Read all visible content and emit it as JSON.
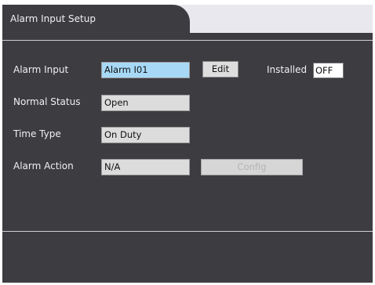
{
  "tab": {
    "title": "Alarm Input Setup"
  },
  "form": {
    "alarm_input": {
      "label": "Alarm Input",
      "value": "Alarm I01",
      "edit_label": "Edit"
    },
    "installed": {
      "label": "Installed",
      "value": "OFF"
    },
    "normal_status": {
      "label": "Normal Status",
      "value": "Open"
    },
    "time_type": {
      "label": "Time Type",
      "value": "On Duty"
    },
    "alarm_action": {
      "label": "Alarm Action",
      "value": "N/A",
      "config_label": "Config"
    }
  },
  "colors": {
    "panel": "#3d3c41",
    "tab_strip": "#e9e8ee",
    "highlight_field": "#a7d9f7"
  }
}
